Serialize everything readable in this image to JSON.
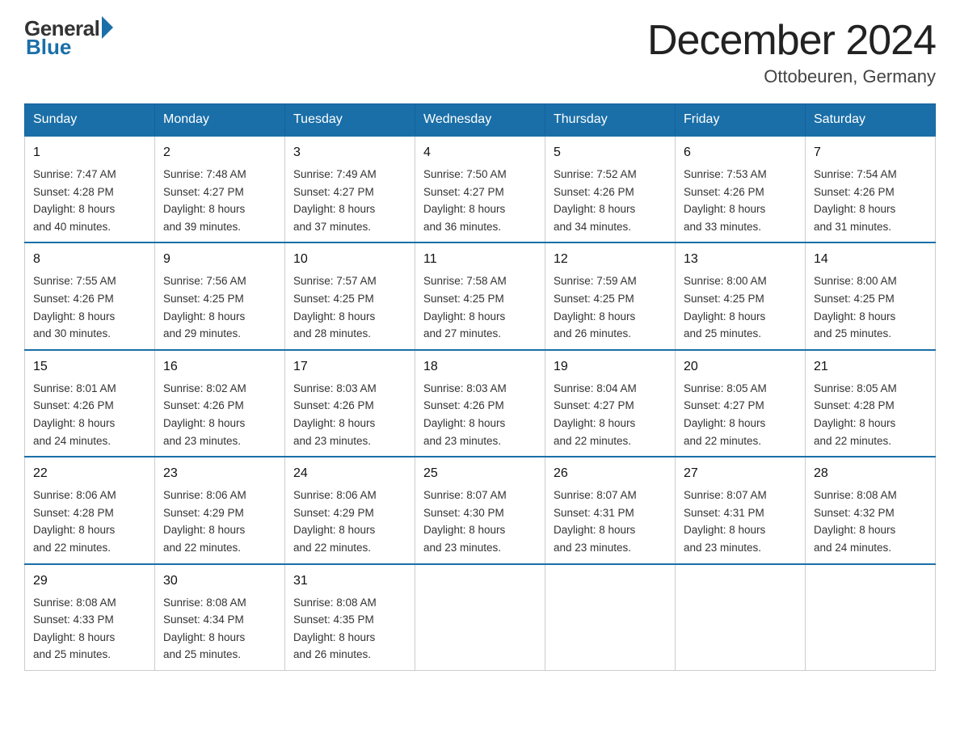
{
  "logo": {
    "general": "General",
    "blue": "Blue"
  },
  "title": "December 2024",
  "location": "Ottobeuren, Germany",
  "weekdays": [
    "Sunday",
    "Monday",
    "Tuesday",
    "Wednesday",
    "Thursday",
    "Friday",
    "Saturday"
  ],
  "weeks": [
    [
      {
        "day": "1",
        "sunrise": "7:47 AM",
        "sunset": "4:28 PM",
        "daylight": "8 hours and 40 minutes."
      },
      {
        "day": "2",
        "sunrise": "7:48 AM",
        "sunset": "4:27 PM",
        "daylight": "8 hours and 39 minutes."
      },
      {
        "day": "3",
        "sunrise": "7:49 AM",
        "sunset": "4:27 PM",
        "daylight": "8 hours and 37 minutes."
      },
      {
        "day": "4",
        "sunrise": "7:50 AM",
        "sunset": "4:27 PM",
        "daylight": "8 hours and 36 minutes."
      },
      {
        "day": "5",
        "sunrise": "7:52 AM",
        "sunset": "4:26 PM",
        "daylight": "8 hours and 34 minutes."
      },
      {
        "day": "6",
        "sunrise": "7:53 AM",
        "sunset": "4:26 PM",
        "daylight": "8 hours and 33 minutes."
      },
      {
        "day": "7",
        "sunrise": "7:54 AM",
        "sunset": "4:26 PM",
        "daylight": "8 hours and 31 minutes."
      }
    ],
    [
      {
        "day": "8",
        "sunrise": "7:55 AM",
        "sunset": "4:26 PM",
        "daylight": "8 hours and 30 minutes."
      },
      {
        "day": "9",
        "sunrise": "7:56 AM",
        "sunset": "4:25 PM",
        "daylight": "8 hours and 29 minutes."
      },
      {
        "day": "10",
        "sunrise": "7:57 AM",
        "sunset": "4:25 PM",
        "daylight": "8 hours and 28 minutes."
      },
      {
        "day": "11",
        "sunrise": "7:58 AM",
        "sunset": "4:25 PM",
        "daylight": "8 hours and 27 minutes."
      },
      {
        "day": "12",
        "sunrise": "7:59 AM",
        "sunset": "4:25 PM",
        "daylight": "8 hours and 26 minutes."
      },
      {
        "day": "13",
        "sunrise": "8:00 AM",
        "sunset": "4:25 PM",
        "daylight": "8 hours and 25 minutes."
      },
      {
        "day": "14",
        "sunrise": "8:00 AM",
        "sunset": "4:25 PM",
        "daylight": "8 hours and 25 minutes."
      }
    ],
    [
      {
        "day": "15",
        "sunrise": "8:01 AM",
        "sunset": "4:26 PM",
        "daylight": "8 hours and 24 minutes."
      },
      {
        "day": "16",
        "sunrise": "8:02 AM",
        "sunset": "4:26 PM",
        "daylight": "8 hours and 23 minutes."
      },
      {
        "day": "17",
        "sunrise": "8:03 AM",
        "sunset": "4:26 PM",
        "daylight": "8 hours and 23 minutes."
      },
      {
        "day": "18",
        "sunrise": "8:03 AM",
        "sunset": "4:26 PM",
        "daylight": "8 hours and 23 minutes."
      },
      {
        "day": "19",
        "sunrise": "8:04 AM",
        "sunset": "4:27 PM",
        "daylight": "8 hours and 22 minutes."
      },
      {
        "day": "20",
        "sunrise": "8:05 AM",
        "sunset": "4:27 PM",
        "daylight": "8 hours and 22 minutes."
      },
      {
        "day": "21",
        "sunrise": "8:05 AM",
        "sunset": "4:28 PM",
        "daylight": "8 hours and 22 minutes."
      }
    ],
    [
      {
        "day": "22",
        "sunrise": "8:06 AM",
        "sunset": "4:28 PM",
        "daylight": "8 hours and 22 minutes."
      },
      {
        "day": "23",
        "sunrise": "8:06 AM",
        "sunset": "4:29 PM",
        "daylight": "8 hours and 22 minutes."
      },
      {
        "day": "24",
        "sunrise": "8:06 AM",
        "sunset": "4:29 PM",
        "daylight": "8 hours and 22 minutes."
      },
      {
        "day": "25",
        "sunrise": "8:07 AM",
        "sunset": "4:30 PM",
        "daylight": "8 hours and 23 minutes."
      },
      {
        "day": "26",
        "sunrise": "8:07 AM",
        "sunset": "4:31 PM",
        "daylight": "8 hours and 23 minutes."
      },
      {
        "day": "27",
        "sunrise": "8:07 AM",
        "sunset": "4:31 PM",
        "daylight": "8 hours and 23 minutes."
      },
      {
        "day": "28",
        "sunrise": "8:08 AM",
        "sunset": "4:32 PM",
        "daylight": "8 hours and 24 minutes."
      }
    ],
    [
      {
        "day": "29",
        "sunrise": "8:08 AM",
        "sunset": "4:33 PM",
        "daylight": "8 hours and 25 minutes."
      },
      {
        "day": "30",
        "sunrise": "8:08 AM",
        "sunset": "4:34 PM",
        "daylight": "8 hours and 25 minutes."
      },
      {
        "day": "31",
        "sunrise": "8:08 AM",
        "sunset": "4:35 PM",
        "daylight": "8 hours and 26 minutes."
      },
      null,
      null,
      null,
      null
    ]
  ],
  "labels": {
    "sunrise": "Sunrise: ",
    "sunset": "Sunset: ",
    "daylight": "Daylight: "
  }
}
